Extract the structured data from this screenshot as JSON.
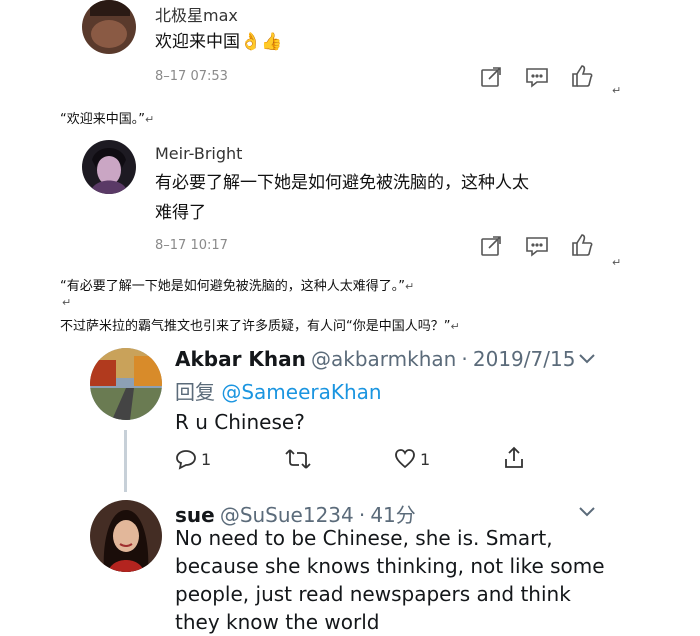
{
  "weibo": [
    {
      "username": "北极星max",
      "text": "欢迎来中国👌👍",
      "time": "8–17 07:53",
      "actions": [
        "share-icon",
        "comment-icon",
        "like-icon"
      ]
    },
    {
      "username": "Meir-Bright",
      "text_line1": "有必要了解一下她是如何避免被洗脑的，这种人太",
      "text_line2": "难得了",
      "time": "8–17 10:17",
      "actions": [
        "share-icon",
        "comment-icon",
        "like-icon"
      ]
    }
  ],
  "captions": {
    "quote1": "“欢迎来中国。”",
    "quote2": "“有必要了解一下她是如何避免被洗脑的，这种人太难得了。”",
    "body": "不过萨米拉的霸气推文也引来了许多质疑，有人问“你是中国人吗？”",
    "mark": "↵"
  },
  "twitter": [
    {
      "name": "Akbar Khan",
      "handle": "@akbarmkhan",
      "dot": "·",
      "date": "2019/7/15",
      "reply_prefix": "回复",
      "reply_to": "@SameeraKhan",
      "text": "R u Chinese?",
      "reply_count": "1",
      "like_count": "1"
    },
    {
      "name": "sue",
      "handle": "@SuSue1234",
      "dot": "·",
      "date": "41分",
      "text_lines": [
        "No need to be Chinese, she is. Smart,",
        "because she knows thinking, not like some",
        "people, just read newspapers and think",
        "they know the world"
      ]
    }
  ]
}
